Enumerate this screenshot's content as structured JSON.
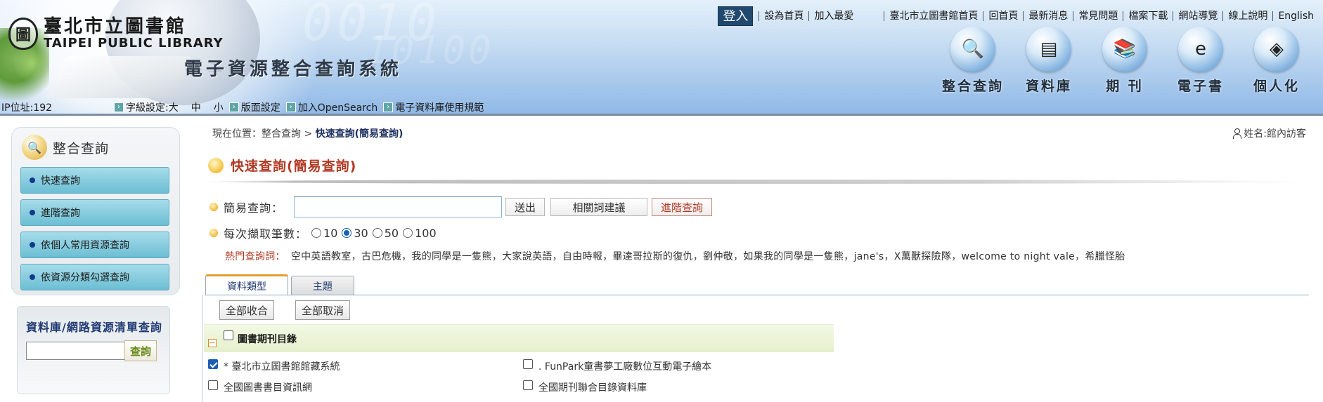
{
  "header": {
    "library_name_zh": "臺北市立圖書館",
    "library_name_en": "TAIPEI PUBLIC LIBRARY",
    "system_title": "電子資源整合查詢系統",
    "emblem_glyph": "圖",
    "login_label": "登入",
    "top_links": [
      "設為首頁",
      "加入最愛",
      "臺北市立圖書館首頁",
      "回首頁",
      "最新消息",
      "常見問題",
      "檔案下載",
      "網站導覽",
      "線上說明",
      "English"
    ],
    "nav": [
      {
        "label": "整合查詢",
        "icon": "magnifier-book-icon",
        "glyph": "🔍"
      },
      {
        "label": "資料庫",
        "icon": "database-icon",
        "glyph": "▤"
      },
      {
        "label": "期 刊",
        "icon": "journal-icon",
        "glyph": "📚"
      },
      {
        "label": "電子書",
        "icon": "ebook-icon",
        "glyph": "e"
      },
      {
        "label": "個人化",
        "icon": "personal-cubes-icon",
        "glyph": "◈"
      }
    ]
  },
  "tool_strip": {
    "ip": "IP位址:192",
    "font_size_label": "字級設定:大",
    "size_mid": "中",
    "size_small": "小",
    "layout": "版面設定",
    "opensearch": "加入OpenSearch",
    "rules": "電子資料庫使用規範"
  },
  "sidebar": {
    "title": "整合查詢",
    "items": [
      "快速查詢",
      "進階查詢",
      "依個人常用資源查詢",
      "依資源分類勾選查詢"
    ]
  },
  "db_search": {
    "title": "資料庫/網路資源清單查詢",
    "input_value": "",
    "submit_label": "查詢"
  },
  "breadcrumb": {
    "prefix": "現在位置：整合查詢 > ",
    "current": "快速查詢(簡易查詢)"
  },
  "user": {
    "name": "姓名:館內訪客"
  },
  "page_title": "快速查詢(簡易查詢)",
  "simple_search": {
    "label": "簡易查詢：",
    "input_value": "",
    "submit_label": "送出",
    "related_label": "相關詞建議",
    "advanced_label": "進階查詢"
  },
  "fetch_count": {
    "label": "每次擷取筆數：",
    "options": [
      "10",
      "30",
      "50",
      "100"
    ],
    "selected": "30"
  },
  "hot_terms": {
    "label": "熱門查詢詞：",
    "text": "空中英語教室，古巴危機，我的同學是一隻熊，大家說英語，自由時報，畢達哥拉斯的復仇，劉仲敬，如果我的同學是一隻熊，jane's，X萬獸探險隊，welcome to night vale，希臘怪胎"
  },
  "tabs": [
    "資料類型",
    "主題"
  ],
  "active_tab": "資料類型",
  "actions": {
    "expand_all": "全部收合",
    "cancel_all": "全部取消"
  },
  "group": {
    "toggle": "−",
    "title": "圖書期刊目錄",
    "checked": false
  },
  "sources": [
    {
      "label": "* 臺北市立圖書館館藏系統",
      "checked": true
    },
    {
      "label": ". FunPark童書夢工廠數位互動電子繪本",
      "checked": false
    },
    {
      "label": "全國圖書書目資訊網",
      "checked": false
    },
    {
      "label": "全國期刊聯合目錄資料庫",
      "checked": false
    }
  ],
  "colors": {
    "accent_red": "#b23a24",
    "nav_blue": "#1f3a73",
    "sidebar_button": "#6cbed4",
    "login_bg": "#21486e"
  }
}
